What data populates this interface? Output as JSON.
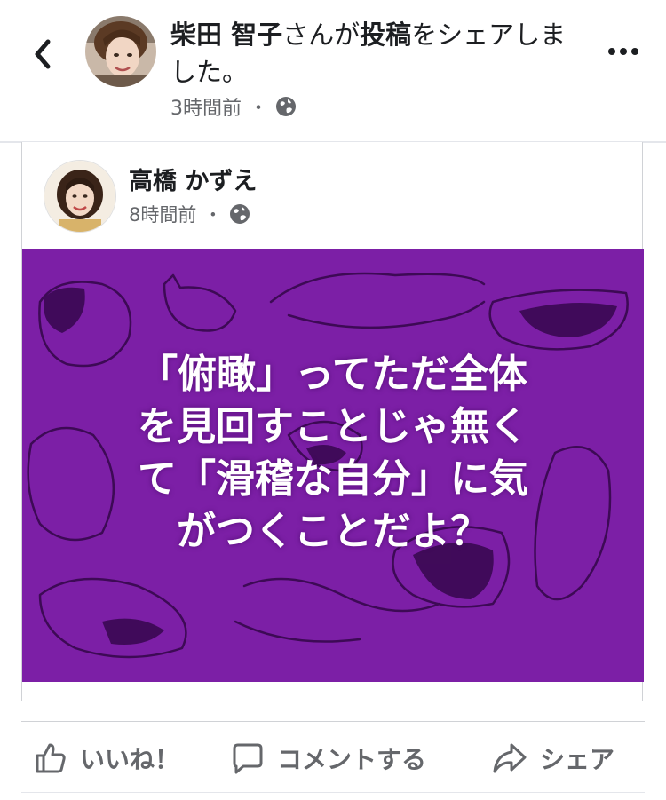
{
  "header": {
    "sharer_name": "柴田 智子",
    "share_mid": "さんが",
    "share_post": "投稿",
    "share_tail": "をシェアしました。",
    "time": "3時間前",
    "dot": "・"
  },
  "post": {
    "author": "高橋 かずえ",
    "time": "8時間前",
    "dot": "・",
    "image_lines": [
      "「俯瞰」ってただ全体",
      "を見回すことじゃ無く",
      "て「滑稽な自分」に気",
      "がつくことだよ？"
    ],
    "image_bg": "#7c1fa6"
  },
  "actions": {
    "like": "いいね！",
    "comment": "コメントする",
    "share": "シェア"
  },
  "colors": {
    "text": "#1c1e21",
    "secondary": "#65676b",
    "purple": "#7c1fa6"
  }
}
